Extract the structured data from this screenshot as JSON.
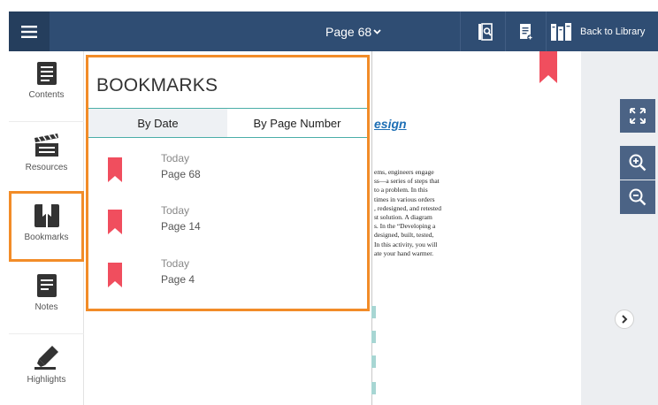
{
  "topbar": {
    "page_label": "Page 68",
    "back_label": "Back to Library",
    "bar_color": "#2f4d73"
  },
  "sidebar": {
    "items": [
      {
        "label": "Contents",
        "icon": "contents-icon"
      },
      {
        "label": "Resources",
        "icon": "resources-icon"
      },
      {
        "label": "Bookmarks",
        "icon": "bookmarks-icon",
        "active": true
      },
      {
        "label": "Notes",
        "icon": "notes-icon"
      },
      {
        "label": "Highlights",
        "icon": "highlights-icon"
      }
    ]
  },
  "bookmarks": {
    "title": "BOOKMARKS",
    "tabs": [
      "By Date",
      "By Page Number"
    ],
    "selected_tab": "By Date",
    "items": [
      {
        "date": "Today",
        "page": "Page 68"
      },
      {
        "date": "Today",
        "page": "Page 14"
      },
      {
        "date": "Today",
        "page": "Page 4"
      }
    ],
    "accent": "#f28c28",
    "ribbon_color": "#f04e5e"
  },
  "doc": {
    "heading_fragment": "esign",
    "lines": [
      "ems, engineers engage",
      "ss—a series of steps that",
      "to a problem. In this",
      "times in various orders",
      ", redesigned, and retested",
      "st solution. A diagram",
      "s. In the “Developing a",
      "designed, built, tested,",
      "In this activity, you will",
      "ate your hand warmer."
    ]
  }
}
